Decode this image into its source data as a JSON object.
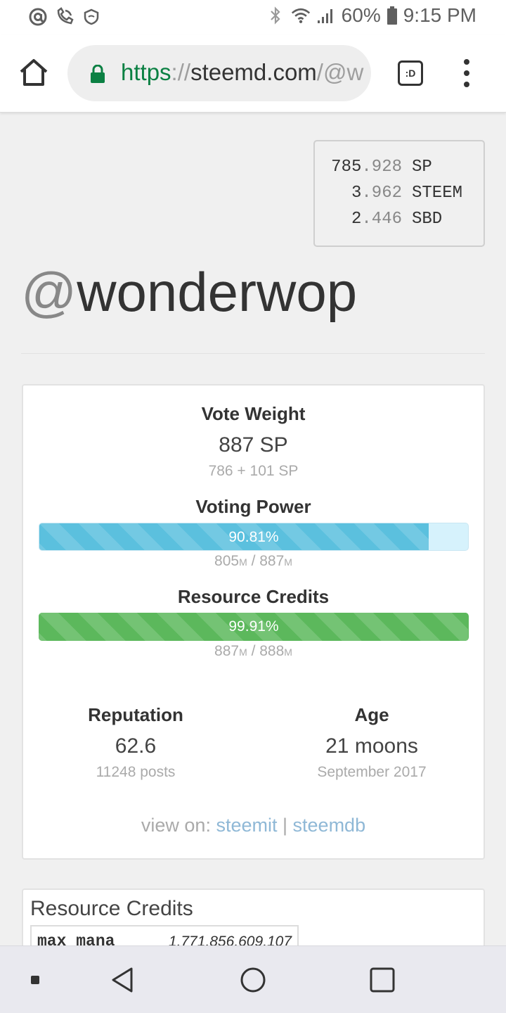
{
  "status_bar": {
    "battery": "60%",
    "time": "9:15 PM"
  },
  "browser": {
    "url_scheme": "https",
    "url_sep": "://",
    "url_host": "steemd.com",
    "url_path": "/@w",
    "tabs_label": ":D"
  },
  "balances": [
    {
      "int": "785",
      "dec": ".928",
      "unit": "SP"
    },
    {
      "int": "3",
      "dec": ".962",
      "unit": "STEEM"
    },
    {
      "int": "2",
      "dec": ".446",
      "unit": "SBD"
    }
  ],
  "profile": {
    "at": "@",
    "name": "wonderwop"
  },
  "vote_weight": {
    "label": "Vote Weight",
    "value": "887 SP",
    "detail": "786 + 101 SP"
  },
  "voting_power": {
    "label": "Voting Power",
    "percent_text": "90.81%",
    "fraction": 0.9081,
    "current": "805",
    "max": "887",
    "unit": "M",
    "slash": " / "
  },
  "resource_credits": {
    "label": "Resource Credits",
    "percent_text": "99.91%",
    "fraction": 0.9991,
    "current": "887",
    "max": "888",
    "unit": "M",
    "slash": " / "
  },
  "reputation": {
    "label": "Reputation",
    "value": "62.6",
    "detail": "11248 posts"
  },
  "age": {
    "label": "Age",
    "value": "21 moons",
    "detail": "September 2017"
  },
  "view_on": {
    "prefix": "view on: ",
    "link1": "steemit",
    "sep": " | ",
    "link2": "steemdb"
  },
  "rc_section": {
    "title": "Resource Credits",
    "row_key": "max mana",
    "row_value": "1,771,856,609,107"
  },
  "colors": {
    "voting_power": "#5bc0de",
    "resource_credits": "#5cb85c",
    "link": "#8fb8d6",
    "url_green": "#0b8043"
  }
}
